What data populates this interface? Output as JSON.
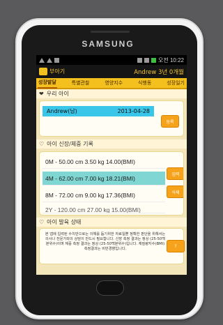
{
  "device": {
    "brand": "SAMSUNG"
  },
  "status_bar": {
    "time": "오전 10:22"
  },
  "app": {
    "title": "부아기",
    "child_info": "Andrew 3년 0개월"
  },
  "tabs": [
    "성장발달",
    "특별관찰",
    "영양지수",
    "식행동",
    "성장일기"
  ],
  "children_section": {
    "heading": "우리 아이",
    "child": {
      "name": "Andrew(남)",
      "birth": "2013-04-28"
    },
    "register_button": "등록"
  },
  "records_section": {
    "heading": "아이 신장/체중 기록",
    "records": [
      "0M - 50.00 cm 3.50 kg 14.00(BMI)",
      "4M - 62.00 cm 7.00 kg 18.21(BMI)",
      "8M - 72.00 cm 9.00 kg 17.36(BMI)",
      "2Y - 120.00 cm 27.00 kg 15.00(BMI)"
    ],
    "input_button": "입력",
    "delete_button": "삭제"
  },
  "development_section": {
    "heading": "아이 발육 상태",
    "note": "본 앱에 입력된 수치만으로는 이해를 돕기위한 자료일뿐 정확한 판단을 위해서는 의사나 전문가와의 상담이 반드시 필요합니다. 신장 측정 결과는 정상 (25-50백분위수)이며 체중 측정 결과는 정상 (25-50백분위수)입니다. 체질량지수(BMI) 측정결과는 비만경향입니다.",
    "help_button": "?"
  },
  "colors": {
    "accent": "#f4c01e",
    "selected_row": "#7fd6d2",
    "child_row": "#39c6e8",
    "button": "#f7a21b"
  }
}
